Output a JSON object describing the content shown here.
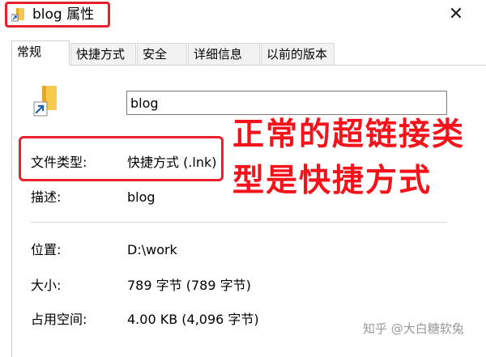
{
  "window": {
    "title": "blog 属性",
    "close_glyph": "✕",
    "title_icon": "shortcut-folder-icon"
  },
  "tabs": [
    {
      "label": "常规",
      "active": true
    },
    {
      "label": "快捷方式",
      "active": false
    },
    {
      "label": "安全",
      "active": false
    },
    {
      "label": "详细信息",
      "active": false
    },
    {
      "label": "以前的版本",
      "active": false
    }
  ],
  "general": {
    "icon": "shortcut-folder-icon",
    "name": "blog",
    "file_type_label": "文件类型:",
    "file_type_value": "快捷方式 (.lnk)",
    "description_label": "描述:",
    "description_value": "blog",
    "location_label": "位置:",
    "location_value": "D:\\work",
    "size_label": "大小:",
    "size_value": "789 字节 (789 字节)",
    "size_on_disk_label": "占用空间:",
    "size_on_disk_value": "4.00 KB (4,096 字节)"
  },
  "annotation": {
    "text": "正常的超链接类型是快捷方式",
    "color": "#f4131a",
    "highlight_color": "#e8212a"
  },
  "watermark": "知乎 @大白糖软兔"
}
